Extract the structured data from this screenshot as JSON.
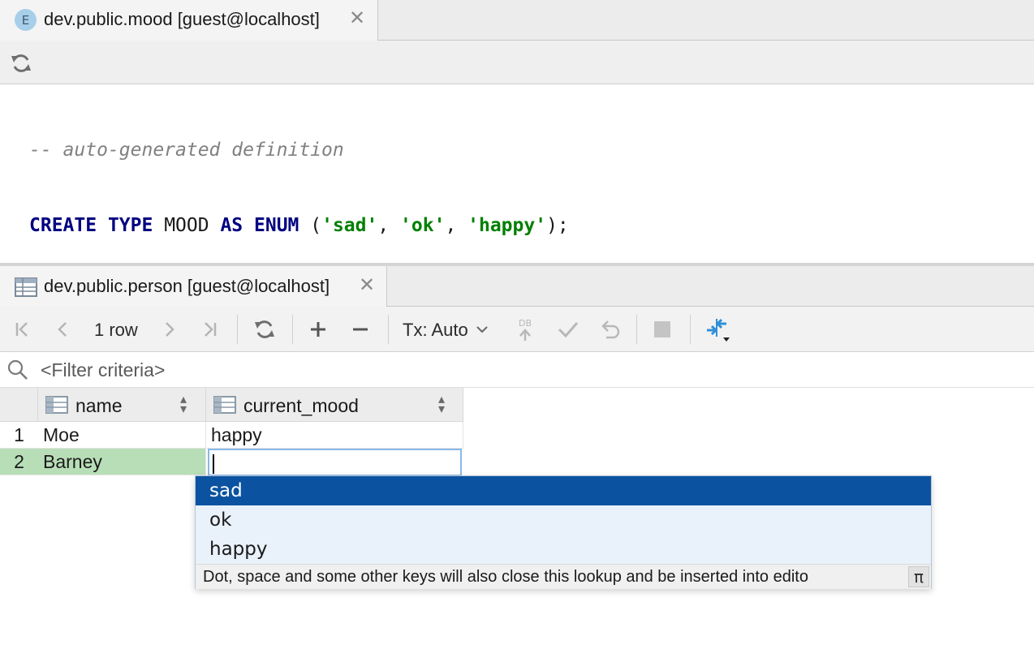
{
  "editor_tab": {
    "icon_letter": "E",
    "label": "dev.public.mood [guest@localhost]",
    "close": "✕"
  },
  "code": {
    "comment": "-- auto-generated definition",
    "line2": [
      {
        "t": "CREATE",
        "c": "kw"
      },
      {
        "t": " ",
        "c": "plain"
      },
      {
        "t": "TYPE",
        "c": "kw"
      },
      {
        "t": " MOOD ",
        "c": "plain"
      },
      {
        "t": "AS",
        "c": "kw"
      },
      {
        "t": " ",
        "c": "plain"
      },
      {
        "t": "ENUM",
        "c": "kw"
      },
      {
        "t": " (",
        "c": "plain"
      },
      {
        "t": "'sad'",
        "c": "str"
      },
      {
        "t": ", ",
        "c": "plain"
      },
      {
        "t": "'ok'",
        "c": "str"
      },
      {
        "t": ", ",
        "c": "plain"
      },
      {
        "t": "'happy'",
        "c": "str"
      },
      {
        "t": ");",
        "c": "plain"
      }
    ]
  },
  "data_tab": {
    "label": "dev.public.person [guest@localhost]",
    "close": "✕"
  },
  "grid_toolbar": {
    "row_count": "1 row",
    "tx_mode": "Tx: Auto",
    "db_badge": "DB"
  },
  "filter": {
    "placeholder": "<Filter criteria>"
  },
  "columns": [
    {
      "label": "name"
    },
    {
      "label": "current_mood"
    }
  ],
  "rows": [
    {
      "num": "1",
      "name": "Moe",
      "current_mood": "happy"
    },
    {
      "num": "2",
      "name": "Barney",
      "current_mood": ""
    }
  ],
  "lookup": {
    "items": [
      "sad",
      "ok",
      "happy"
    ],
    "selected_index": 0,
    "hint": "Dot, space and some other keys will also close this lookup and be inserted into edito",
    "pi_symbol": "π"
  },
  "colors": {
    "selected_row": "#b8deb8",
    "lookup_selected": "#0b52a1",
    "keyword": "#000080",
    "string": "#008000"
  }
}
